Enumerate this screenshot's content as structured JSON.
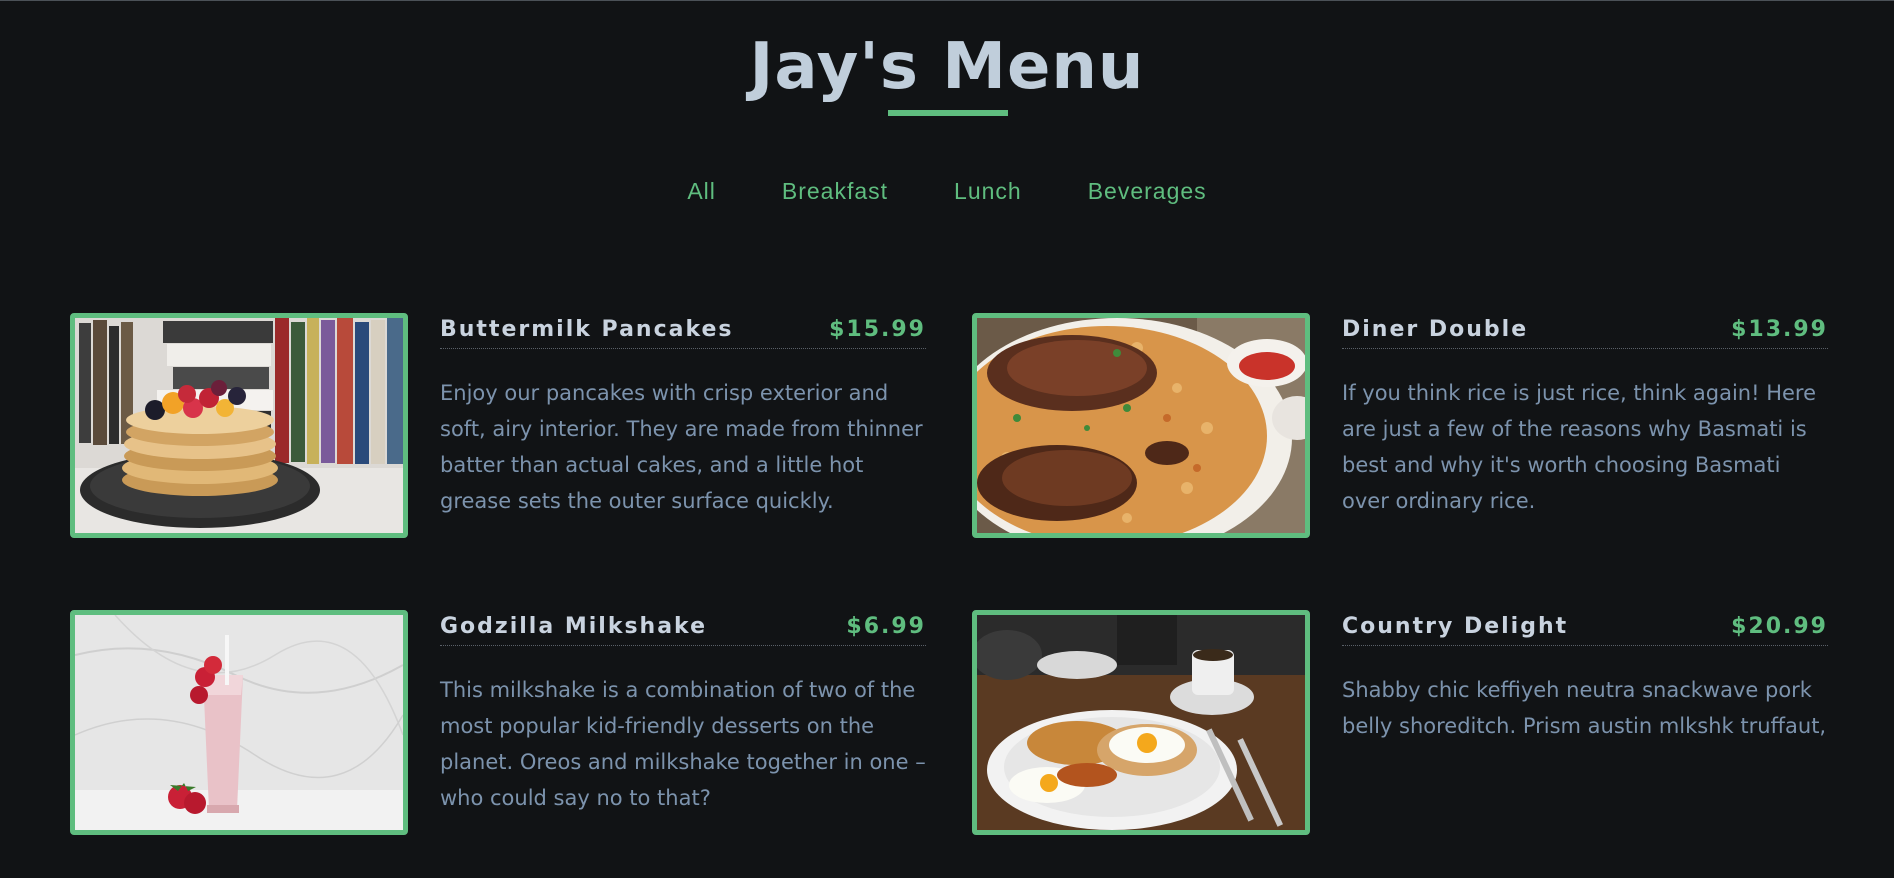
{
  "header": {
    "title": "Jay's Menu"
  },
  "filters": [
    "All",
    "Breakfast",
    "Lunch",
    "Beverages"
  ],
  "colors": {
    "background": "#111315",
    "accent": "#5fbd7f",
    "title": "#c0cedb",
    "description": "#7c93ad"
  },
  "items": [
    {
      "name": "Buttermilk Pancakes",
      "price": "$15.99",
      "description": "Enjoy our pancakes with crisp exterior and soft, airy interior. They are made from thinner batter than actual cakes, and a little hot grease sets the outer surface quickly.",
      "image": "pancakes-photo"
    },
    {
      "name": "Diner Double",
      "price": "$13.99",
      "description": "If you think rice is just rice, think again! Here are just a few of the reasons why Basmati is best and why it's worth choosing Basmati over ordinary rice.",
      "image": "chicken-rice-photo"
    },
    {
      "name": "Godzilla Milkshake",
      "price": "$6.99",
      "description": "This milkshake is a combination of two of the most popular kid-friendly desserts on the planet. Oreos and milkshake together in one – who could say no to that?",
      "image": "milkshake-photo"
    },
    {
      "name": "Country Delight",
      "price": "$20.99",
      "description": "Shabby chic keffiyeh neutra snackwave pork belly shoreditch. Prism austin mlkshk truffaut,",
      "image": "breakfast-plate-photo"
    }
  ]
}
